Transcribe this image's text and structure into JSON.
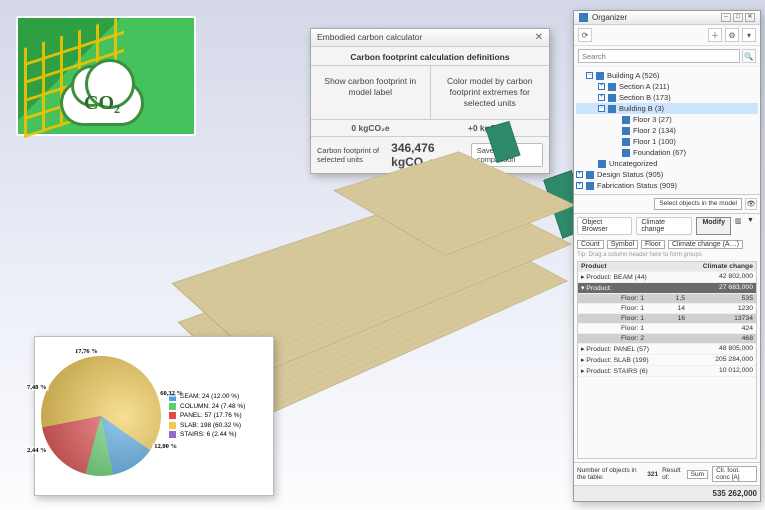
{
  "logo": {
    "text": "CO₂"
  },
  "calc": {
    "title": "Embodied carbon calculator",
    "subtitle": "Carbon footprint calculation definitions",
    "btn1": "Show carbon footprint in model label",
    "btn2": "Color model by carbon footprint extremes for selected units",
    "val1": "0 kgCO₂e",
    "val2": "+0 kgCO₂e",
    "footLabel": "Carbon footprint of selected units",
    "footValue": "346,476 kgCO₂e",
    "saveBtn": "Save for comparison"
  },
  "organizer": {
    "title": "Organizer",
    "searchPlaceholder": "Search",
    "tree": [
      {
        "indent": 1,
        "exp": "−",
        "label": "Building A (526)"
      },
      {
        "indent": 2,
        "exp": "+",
        "label": "Section A (211)"
      },
      {
        "indent": 2,
        "exp": "+",
        "label": "Section B (173)"
      },
      {
        "indent": 2,
        "exp": "−",
        "label": "Building B (3)",
        "sel": true
      },
      {
        "indent": 3,
        "exp": "",
        "label": "Floor 3 (27)"
      },
      {
        "indent": 3,
        "exp": "",
        "label": "Floor 2 (134)"
      },
      {
        "indent": 3,
        "exp": "",
        "label": "Floor 1 (100)"
      },
      {
        "indent": 3,
        "exp": "",
        "label": "Foundation (67)"
      },
      {
        "indent": 1,
        "exp": "",
        "label": "Uncategorized"
      },
      {
        "indent": 0,
        "exp": "+",
        "label": "Design Status (905)"
      },
      {
        "indent": 0,
        "exp": "+",
        "label": "Fabrication Status (909)"
      }
    ],
    "selectBtn": "Select objects in the model",
    "tabs": {
      "t1": "Object Browser",
      "t2": "Climate change",
      "mod": "Modify"
    },
    "groupRow": {
      "a": "Count",
      "b": "Symbol",
      "c": "Floor",
      "d": "Climate change (A…)"
    },
    "tip": "Tip: Drag a column header here to form groups",
    "table": {
      "headers": [
        "Product",
        "",
        "",
        "Climate change"
      ],
      "rows": [
        {
          "cls": "",
          "c1": "▸ Product: BEAM (44)",
          "c2": "",
          "c3": "42 802,000"
        },
        {
          "cls": "dark",
          "c1": "▾ Product:",
          "c2": "",
          "c3": "27 683,000"
        },
        {
          "cls": "grey",
          "c1sub": "Floor: 1",
          "c2": "1,5",
          "c3": "535"
        },
        {
          "cls": "",
          "c1sub": "Floor: 1",
          "c2": "14",
          "c3": "1230"
        },
        {
          "cls": "grey",
          "c1sub": "Floor: 1",
          "c2": "16",
          "c3": "13734"
        },
        {
          "cls": "",
          "c1sub": "Floor: 1",
          "c2": "",
          "c3": "424"
        },
        {
          "cls": "grey",
          "c1sub": "Floor: 2",
          "c2": "",
          "c3": "468"
        },
        {
          "cls": "",
          "c1": "▸ Product: PANEL (57)",
          "c2": "",
          "c3": "48 805,000"
        },
        {
          "cls": "",
          "c1": "▸ Product: SLAB (199)",
          "c2": "",
          "c3": "205 284,000"
        },
        {
          "cls": "",
          "c1": "▸ Product: STAIRS (6)",
          "c2": "",
          "c3": "10 012,000"
        }
      ]
    },
    "footer": {
      "lbl": "Number of objects in the table:",
      "count": "321",
      "resLbl": "Result of:",
      "resSel": "Sum",
      "unitSel": "Cli. foot. conc [A]"
    },
    "total": "535 262,000"
  },
  "chart_data": {
    "type": "pie",
    "title": "",
    "series": [
      {
        "name": "BEAM: 24 (12.00 %)",
        "value": 12.0,
        "color": "#4aa3e0",
        "label": "12,00 %"
      },
      {
        "name": "COLUMN: 24 (7.48 %)",
        "value": 7.48,
        "color": "#5ecf6d",
        "label": "7,48 %"
      },
      {
        "name": "PANEL: 57 (17.76 %)",
        "value": 17.76,
        "color": "#e14b4b",
        "label": "17,76 %"
      },
      {
        "name": "SLAB: 198 (60.32 %)",
        "value": 60.32,
        "color": "#f2c94c",
        "label": "60,32 %"
      },
      {
        "name": "STAIRS: 6 (2.44 %)",
        "value": 2.44,
        "color": "#8e6cc9",
        "label": "2,44 %"
      }
    ]
  }
}
